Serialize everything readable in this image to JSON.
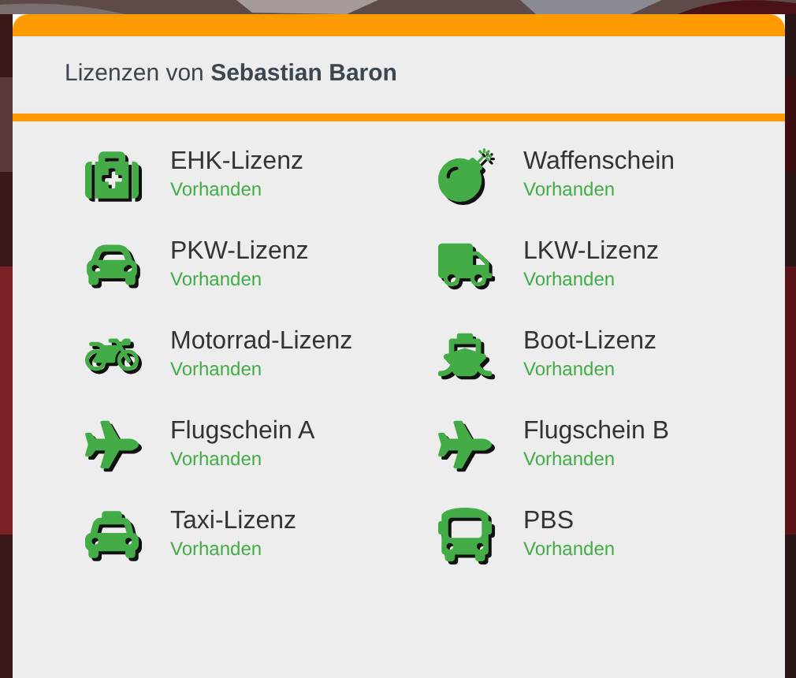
{
  "header": {
    "title": "Lizenzen von **Sebastian Baron**"
  },
  "licenses": [
    {
      "kind": "medkit",
      "name": "EHK-Lizenz",
      "status": "Vorhanden",
      "available": true
    },
    {
      "kind": "bomb",
      "name": "Waffenschein",
      "status": "Vorhanden",
      "available": true
    },
    {
      "kind": "car",
      "name": "PKW-Lizenz",
      "status": "Vorhanden",
      "available": true
    },
    {
      "kind": "truck",
      "name": "LKW-Lizenz",
      "status": "Vorhanden",
      "available": true
    },
    {
      "kind": "motorcycle",
      "name": "Motorrad-Lizenz",
      "status": "Vorhanden",
      "available": true
    },
    {
      "kind": "ship",
      "name": "Boot-Lizenz",
      "status": "Vorhanden",
      "available": true
    },
    {
      "kind": "plane",
      "name": "Flugschein A",
      "status": "Vorhanden",
      "available": true
    },
    {
      "kind": "plane",
      "name": "Flugschein B",
      "status": "Vorhanden",
      "available": true
    },
    {
      "kind": "taxi",
      "name": "Taxi-Lizenz",
      "status": "Vorhanden",
      "available": true
    },
    {
      "kind": "bus",
      "name": "PBS",
      "status": "Vorhanden",
      "available": true
    }
  ]
}
